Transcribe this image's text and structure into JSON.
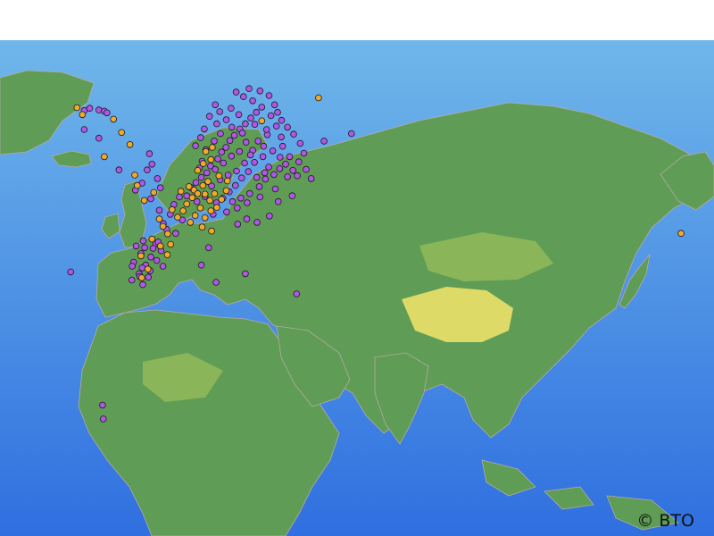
{
  "credit": "© BTO",
  "colors": {
    "ocean_shallow": "#6fb7ea",
    "ocean_deep": "#2f6fe0",
    "land_low": "#5f9c55",
    "land_mid": "#8fb95a",
    "land_high": "#e8e06a",
    "border": "#b8a9a6",
    "marker_purple": "#b056e8",
    "marker_orange": "#f2a92a",
    "marker_stroke": "#1a1a1a"
  },
  "chart_data": {
    "type": "scatter",
    "title": "",
    "xlabel": "",
    "ylabel": "",
    "xlim": [
      -45,
      150
    ],
    "ylim": [
      -8,
      78
    ],
    "series": [
      {
        "color": "#b056e8",
        "points": [
          [
            -22,
            65.8
          ],
          [
            -20.5,
            66.2
          ],
          [
            -18,
            65.9
          ],
          [
            -16.5,
            65.7
          ],
          [
            -15.8,
            65.4
          ],
          [
            -3.8,
            40.4
          ],
          [
            -5.9,
            43.2
          ],
          [
            -6.5,
            41.0
          ],
          [
            -5.2,
            39.0
          ],
          [
            -7.0,
            37.5
          ],
          [
            -8.5,
            39.5
          ],
          [
            -6.8,
            37.0
          ],
          [
            -4.5,
            36.9
          ],
          [
            -2.2,
            39.8
          ],
          [
            -1.0,
            41.5
          ],
          [
            -2.5,
            42.7
          ],
          [
            -0.5,
            38.8
          ],
          [
            -4.0,
            38.0
          ],
          [
            -6.2,
            38.5
          ],
          [
            -5.5,
            42.0
          ],
          [
            -7.8,
            42.3
          ],
          [
            -3.2,
            41.9
          ],
          [
            -1.8,
            43.0
          ],
          [
            -8.9,
            38.8
          ],
          [
            -9.0,
            36.4
          ],
          [
            -6.0,
            35.6
          ],
          [
            -25.7,
            37.8
          ],
          [
            -17.0,
            14.7
          ],
          [
            -16.8,
            12.3
          ],
          [
            36.0,
            34.0
          ],
          [
            14.0,
            36.0
          ],
          [
            22.0,
            37.5
          ],
          [
            10.0,
            39.0
          ],
          [
            12.0,
            42.0
          ],
          [
            -0.4,
            46.2
          ],
          [
            1.5,
            47.8
          ],
          [
            0.5,
            45.2
          ],
          [
            3.0,
            44.5
          ],
          [
            4.8,
            46.8
          ],
          [
            -1.5,
            48.5
          ],
          [
            2.5,
            49.5
          ],
          [
            4.0,
            50.8
          ],
          [
            6.0,
            51.0
          ],
          [
            7.2,
            52.4
          ],
          [
            8.5,
            53.3
          ],
          [
            10.0,
            54.2
          ],
          [
            11.5,
            55.0
          ],
          [
            9.5,
            55.8
          ],
          [
            10.2,
            57.0
          ],
          [
            12.5,
            56.2
          ],
          [
            13.8,
            55.6
          ],
          [
            14.5,
            57.4
          ],
          [
            15.5,
            58.6
          ],
          [
            16.7,
            59.4
          ],
          [
            17.8,
            60.6
          ],
          [
            19.0,
            61.5
          ],
          [
            20.5,
            62.6
          ],
          [
            22.0,
            63.5
          ],
          [
            23.5,
            64.5
          ],
          [
            25.0,
            65.5
          ],
          [
            26.5,
            66.4
          ],
          [
            24.0,
            67.5
          ],
          [
            21.5,
            68.2
          ],
          [
            19.5,
            69.0
          ],
          [
            23.0,
            69.6
          ],
          [
            26.0,
            69.2
          ],
          [
            28.5,
            68.4
          ],
          [
            30.0,
            66.8
          ],
          [
            29.0,
            64.9
          ],
          [
            30.5,
            63.1
          ],
          [
            28.0,
            61.6
          ],
          [
            25.5,
            60.5
          ],
          [
            27.0,
            59.6
          ],
          [
            29.5,
            58.8
          ],
          [
            31.5,
            57.7
          ],
          [
            33.0,
            56.5
          ],
          [
            35.0,
            55.4
          ],
          [
            36.6,
            56.9
          ],
          [
            38.0,
            58.4
          ],
          [
            37.0,
            60.1
          ],
          [
            35.2,
            61.7
          ],
          [
            33.5,
            62.9
          ],
          [
            31.8,
            61.2
          ],
          [
            24.5,
            56.8
          ],
          [
            22.8,
            55.2
          ],
          [
            21.0,
            54.1
          ],
          [
            19.3,
            52.8
          ],
          [
            17.6,
            51.7
          ],
          [
            15.9,
            50.6
          ],
          [
            14.1,
            49.8
          ],
          [
            18.5,
            50.0
          ],
          [
            20.8,
            50.6
          ],
          [
            23.2,
            51.4
          ],
          [
            25.8,
            52.6
          ],
          [
            27.5,
            53.9
          ],
          [
            29.8,
            54.7
          ],
          [
            31.4,
            55.7
          ],
          [
            26.8,
            57.8
          ],
          [
            24.0,
            58.9
          ],
          [
            22.2,
            60.3
          ],
          [
            21.2,
            61.9
          ],
          [
            18.3,
            62.9
          ],
          [
            16.8,
            64.2
          ],
          [
            15.0,
            65.6
          ],
          [
            13.8,
            66.8
          ],
          [
            12.2,
            64.8
          ],
          [
            10.8,
            62.6
          ],
          [
            9.8,
            61.1
          ],
          [
            8.4,
            59.7
          ],
          [
            11.2,
            59.0
          ],
          [
            13.5,
            60.5
          ],
          [
            15.2,
            61.8
          ],
          [
            14.2,
            63.5
          ],
          [
            18.1,
            66.2
          ],
          [
            20.2,
            65.1
          ],
          [
            27.8,
            62.5
          ],
          [
            32.2,
            59.6
          ],
          [
            34.1,
            57.8
          ],
          [
            36.2,
            54.5
          ],
          [
            38.6,
            55.6
          ],
          [
            28.4,
            56.0
          ],
          [
            30.2,
            52.2
          ],
          [
            26.0,
            50.8
          ],
          [
            22.5,
            49.8
          ],
          [
            19.8,
            48.9
          ],
          [
            16.9,
            48.2
          ],
          [
            13.2,
            47.8
          ],
          [
            11.0,
            50.9
          ],
          [
            8.8,
            50.0
          ],
          [
            12.8,
            52.7
          ],
          [
            15.1,
            53.8
          ],
          [
            17.3,
            54.6
          ],
          [
            19.6,
            55.3
          ],
          [
            21.8,
            56.7
          ],
          [
            23.4,
            58.1
          ],
          [
            20.4,
            58.7
          ],
          [
            18.2,
            57.9
          ],
          [
            16.0,
            56.7
          ],
          [
            -2.0,
            54.0
          ],
          [
            -3.5,
            56.5
          ],
          [
            -4.8,
            55.5
          ],
          [
            -1.2,
            52.4
          ],
          [
            -3.8,
            50.5
          ],
          [
            -6.2,
            53.2
          ],
          [
            -8.0,
            52.0
          ],
          [
            -4.2,
            58.3
          ],
          [
            -12.5,
            55.5
          ],
          [
            -18.0,
            61.0
          ],
          [
            -22.0,
            62.5
          ],
          [
            30.8,
            65.5
          ],
          [
            31.9,
            64.1
          ],
          [
            27.3,
            55.0
          ],
          [
            25.1,
            54.2
          ],
          [
            33.5,
            54.3
          ],
          [
            24.6,
            63.4
          ],
          [
            43.5,
            60.5
          ],
          [
            51.0,
            61.8
          ],
          [
            40.0,
            54.0
          ],
          [
            34.8,
            51.0
          ],
          [
            31.0,
            50.0
          ],
          [
            28.6,
            47.5
          ],
          [
            25.2,
            46.4
          ],
          [
            22.4,
            47.0
          ],
          [
            19.9,
            46.1
          ]
        ]
      },
      {
        "color": "#f2a92a",
        "points": [
          [
            -24.0,
            66.3
          ],
          [
            -22.5,
            65.1
          ],
          [
            -14.0,
            64.3
          ],
          [
            -11.8,
            62.0
          ],
          [
            -9.5,
            59.9
          ],
          [
            -8.2,
            54.6
          ],
          [
            -7.5,
            52.8
          ],
          [
            -5.6,
            50.2
          ],
          [
            -3.0,
            51.6
          ],
          [
            -16.5,
            57.8
          ],
          [
            -1.5,
            47.0
          ],
          [
            -0.5,
            45.7
          ],
          [
            0.8,
            44.4
          ],
          [
            -3.5,
            43.5
          ],
          [
            -6.5,
            40.6
          ],
          [
            -4.6,
            38.3
          ],
          [
            -6.3,
            36.8
          ],
          [
            0.7,
            40.8
          ],
          [
            2.0,
            48.6
          ],
          [
            3.5,
            47.3
          ],
          [
            5.0,
            48.4
          ],
          [
            6.0,
            49.6
          ],
          [
            4.4,
            51.8
          ],
          [
            6.6,
            52.6
          ],
          [
            8.0,
            52.0
          ],
          [
            7.5,
            50.7
          ],
          [
            9.0,
            51.4
          ],
          [
            10.4,
            52.8
          ],
          [
            11.8,
            53.5
          ],
          [
            11.0,
            51.3
          ],
          [
            12.3,
            50.2
          ],
          [
            13.6,
            51.4
          ],
          [
            9.7,
            48.9
          ],
          [
            8.3,
            47.6
          ],
          [
            11.0,
            47.2
          ],
          [
            12.6,
            48.4
          ],
          [
            14.2,
            49.0
          ],
          [
            15.5,
            50.4
          ],
          [
            16.8,
            51.9
          ],
          [
            9.0,
            55.4
          ],
          [
            10.5,
            56.6
          ],
          [
            12.6,
            57.3
          ],
          [
            11.2,
            58.7
          ],
          [
            13.0,
            59.4
          ],
          [
            17.1,
            53.6
          ],
          [
            14.8,
            54.5
          ],
          [
            7.0,
            46.4
          ],
          [
            10.2,
            45.6
          ],
          [
            12.8,
            44.9
          ],
          [
            1.6,
            42.6
          ],
          [
            -1.2,
            42.3
          ],
          [
            26.5,
            64.0
          ],
          [
            42.0,
            68.0
          ],
          [
            141.0,
            44.5
          ]
        ]
      }
    ]
  }
}
